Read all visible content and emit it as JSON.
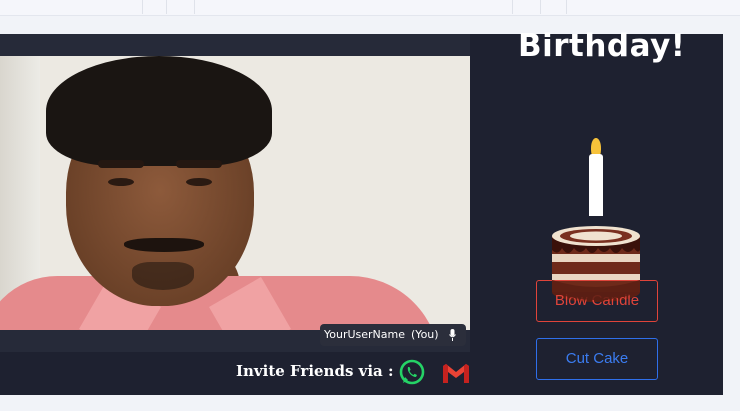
{
  "birthday": {
    "title": "Birthday!",
    "blow_candle_label": "Blow Candle",
    "cut_cake_label": "Cut Cake"
  },
  "video": {
    "username": "YourUserName",
    "you_tag": "(You)"
  },
  "invite": {
    "label": "Invite Friends via :",
    "icons": [
      "whatsapp-icon",
      "gmail-icon"
    ]
  },
  "colors": {
    "app_bg": "#1e2130",
    "blow_candle": "#e0443a",
    "cut_cake": "#2f6fea",
    "whatsapp": "#25d366",
    "gmail": "#ea4335"
  }
}
